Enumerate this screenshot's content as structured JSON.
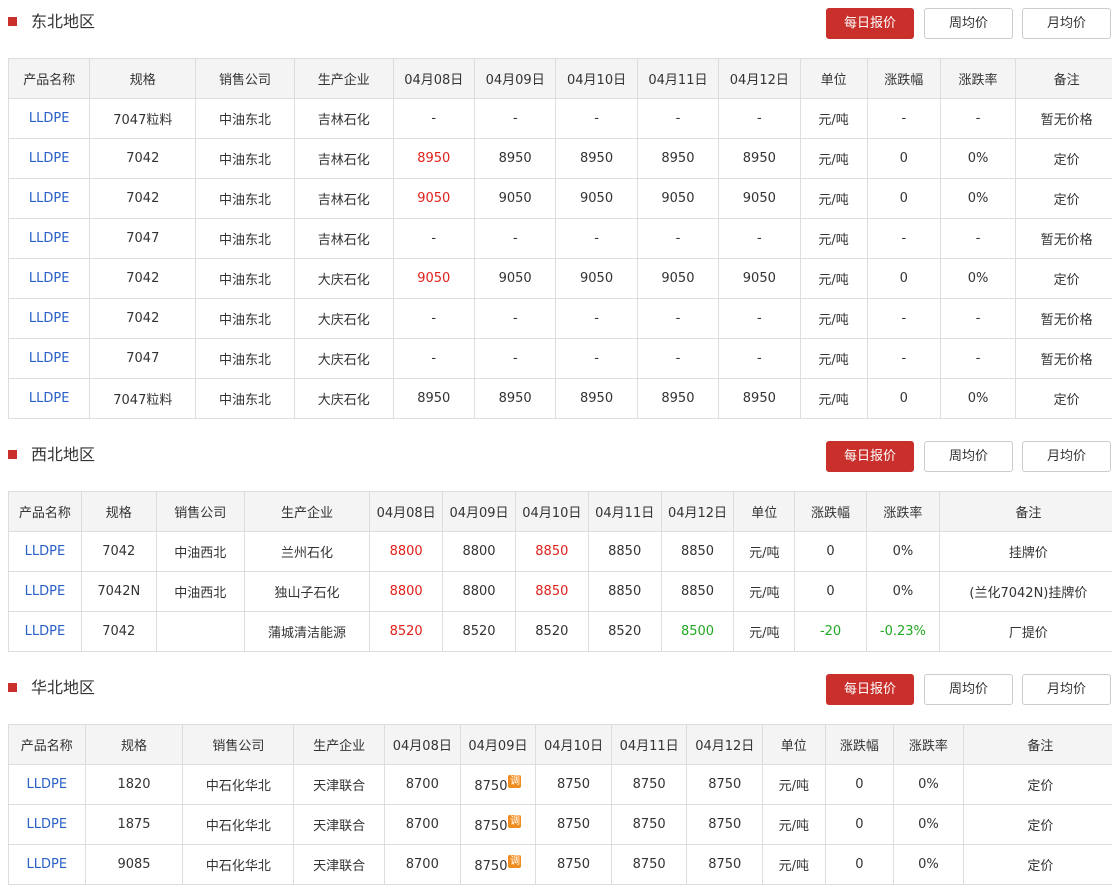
{
  "buttons": {
    "daily": "每日报价",
    "weekly": "周均价",
    "monthly": "月均价"
  },
  "regions": [
    {
      "title": "东北地区",
      "headers": [
        "产品名称",
        "规格",
        "销售公司",
        "生产企业",
        "04月08日",
        "04月09日",
        "04月10日",
        "04月11日",
        "04月12日",
        "单位",
        "涨跌幅",
        "涨跌率",
        "备注"
      ],
      "rows": [
        [
          "LLDPE",
          "7047粒料",
          "中油东北",
          "吉林石化",
          "-",
          "-",
          "-",
          "-",
          "-",
          "元/吨",
          "-",
          "-",
          "暂无价格"
        ],
        [
          "LLDPE",
          "7042",
          "中油东北",
          "吉林石化",
          "8950",
          "8950",
          "8950",
          "8950",
          "8950",
          "元/吨",
          "0",
          "0%",
          "定价"
        ],
        [
          "LLDPE",
          "7042",
          "中油东北",
          "吉林石化",
          "9050",
          "9050",
          "9050",
          "9050",
          "9050",
          "元/吨",
          "0",
          "0%",
          "定价"
        ],
        [
          "LLDPE",
          "7047",
          "中油东北",
          "吉林石化",
          "-",
          "-",
          "-",
          "-",
          "-",
          "元/吨",
          "-",
          "-",
          "暂无价格"
        ],
        [
          "LLDPE",
          "7042",
          "中油东北",
          "大庆石化",
          "9050",
          "9050",
          "9050",
          "9050",
          "9050",
          "元/吨",
          "0",
          "0%",
          "定价"
        ],
        [
          "LLDPE",
          "7042",
          "中油东北",
          "大庆石化",
          "-",
          "-",
          "-",
          "-",
          "-",
          "元/吨",
          "-",
          "-",
          "暂无价格"
        ],
        [
          "LLDPE",
          "7047",
          "中油东北",
          "大庆石化",
          "-",
          "-",
          "-",
          "-",
          "-",
          "元/吨",
          "-",
          "-",
          "暂无价格"
        ],
        [
          "LLDPE",
          "7047粒料",
          "中油东北",
          "大庆石化",
          "8950",
          "8950",
          "8950",
          "8950",
          "8950",
          "元/吨",
          "0",
          "0%",
          "定价"
        ]
      ],
      "red_cells": [
        [
          1,
          4
        ],
        [
          2,
          4
        ],
        [
          4,
          4
        ]
      ],
      "green_cells": []
    },
    {
      "title": "西北地区",
      "headers": [
        "产品名称",
        "规格",
        "销售公司",
        "生产企业",
        "04月08日",
        "04月09日",
        "04月10日",
        "04月11日",
        "04月12日",
        "单位",
        "涨跌幅",
        "涨跌率",
        "备注"
      ],
      "rows": [
        [
          "LLDPE",
          "7042",
          "中油西北",
          "兰州石化",
          "8800",
          "8800",
          "8850",
          "8850",
          "8850",
          "元/吨",
          "0",
          "0%",
          "挂牌价"
        ],
        [
          "LLDPE",
          "7042N",
          "中油西北",
          "独山子石化",
          "8800",
          "8800",
          "8850",
          "8850",
          "8850",
          "元/吨",
          "0",
          "0%",
          "(兰化7042N)挂牌价"
        ],
        [
          "LLDPE",
          "7042",
          "",
          "蒲城清洁能源",
          "8520",
          "8520",
          "8520",
          "8520",
          "8500",
          "元/吨",
          "-20",
          "-0.23%",
          "厂提价"
        ]
      ],
      "red_cells": [
        [
          0,
          4
        ],
        [
          0,
          6
        ],
        [
          1,
          4
        ],
        [
          1,
          6
        ],
        [
          2,
          4
        ]
      ],
      "green_cells": [
        [
          2,
          8
        ],
        [
          2,
          10
        ],
        [
          2,
          11
        ]
      ]
    },
    {
      "title": "华北地区",
      "headers": [
        "产品名称",
        "规格",
        "销售公司",
        "生产企业",
        "04月08日",
        "04月09日",
        "04月10日",
        "04月11日",
        "04月12日",
        "单位",
        "涨跌幅",
        "涨跌率",
        "备注"
      ],
      "rows": [
        [
          "LLDPE",
          "1820",
          "中石化华北",
          "天津联合",
          "8700",
          "8750",
          "8750",
          "8750",
          "8750",
          "元/吨",
          "0",
          "0%",
          "定价"
        ],
        [
          "LLDPE",
          "1875",
          "中石化华北",
          "天津联合",
          "8700",
          "8750",
          "8750",
          "8750",
          "8750",
          "元/吨",
          "0",
          "0%",
          "定价"
        ],
        [
          "LLDPE",
          "9085",
          "中石化华北",
          "天津联合",
          "8700",
          "8750",
          "8750",
          "8750",
          "8750",
          "元/吨",
          "0",
          "0%",
          "定价"
        ]
      ],
      "red_cells": [],
      "green_cells": [],
      "adjust_badge": {
        "label": "调",
        "column": 5
      }
    }
  ],
  "colors": {
    "accent": "#c9302c",
    "up": "#e0201b",
    "down": "#22a822",
    "link": "#2a5fc8"
  }
}
